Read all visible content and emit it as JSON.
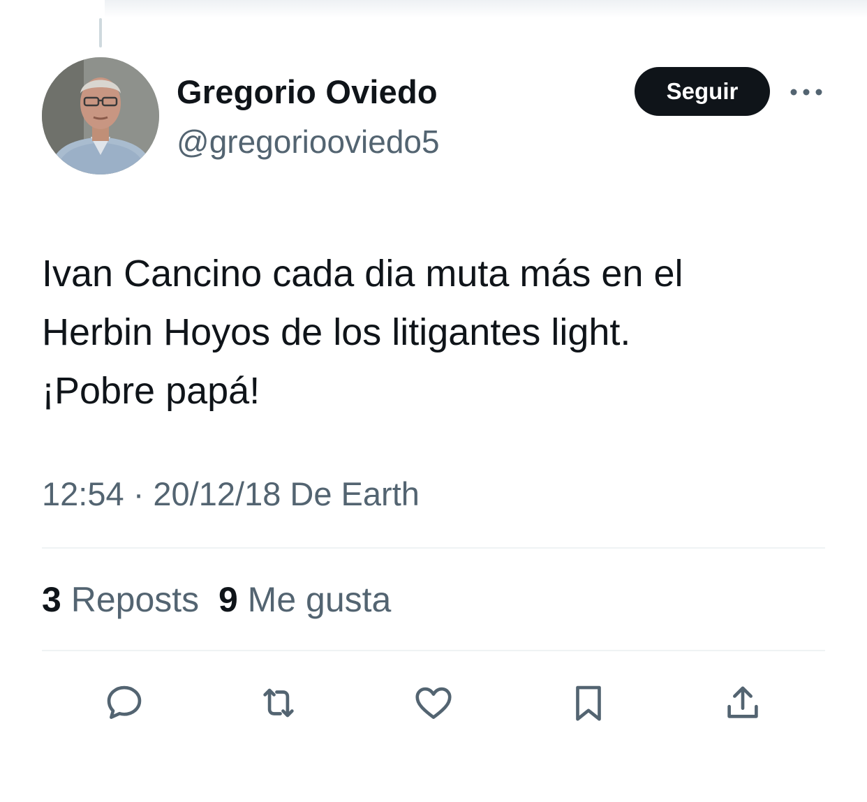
{
  "author": {
    "name": "Gregorio Oviedo",
    "handle": "@gregoriooviedo5"
  },
  "follow_button": {
    "label": "Seguir"
  },
  "more_button": {
    "icon": "more-dots-icon"
  },
  "tweet": {
    "text": "Ivan Cancino cada dia muta más en el\nHerbin Hoyos de los litigantes light.\n¡Pobre papá!"
  },
  "meta": {
    "time": "12:54",
    "separator": "·",
    "date": "20/12/18",
    "source": "De Earth"
  },
  "stats": {
    "reposts_count": "3",
    "reposts_label": "Reposts",
    "likes_count": "9",
    "likes_label": "Me gusta"
  },
  "actions": [
    {
      "icon": "reply-icon"
    },
    {
      "icon": "repost-icon"
    },
    {
      "icon": "like-icon"
    },
    {
      "icon": "bookmark-icon"
    },
    {
      "icon": "share-icon"
    }
  ],
  "colors": {
    "text_primary": "#0f1419",
    "text_secondary": "#536471",
    "button_bg": "#0f1419",
    "divider": "#eff3f4"
  }
}
